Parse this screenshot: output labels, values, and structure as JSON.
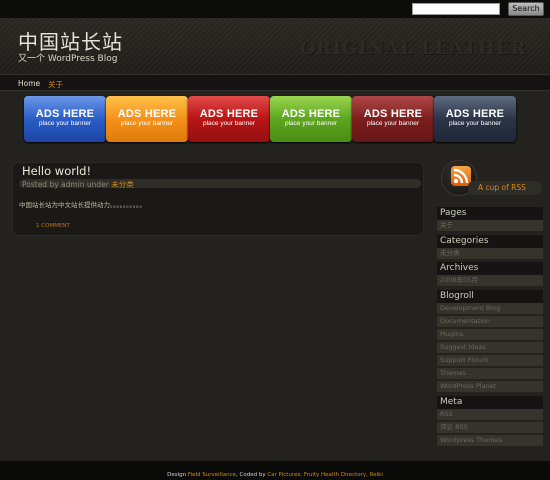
{
  "search": {
    "value": "",
    "button_label": "Search"
  },
  "header": {
    "title": "中国站长站",
    "tagline": "又一个 WordPress Blog",
    "watermark": "ORIGINAL LEATHER"
  },
  "nav": {
    "items": [
      {
        "label": "Home"
      },
      {
        "label": "关于"
      }
    ]
  },
  "ads": [
    {
      "title": "ADS HERE",
      "subtitle": "place your banner"
    },
    {
      "title": "ADS HERE",
      "subtitle": "place your banner"
    },
    {
      "title": "ADS HERE",
      "subtitle": "place your banner"
    },
    {
      "title": "ADS HERE",
      "subtitle": "place your banner"
    },
    {
      "title": "ADS HERE",
      "subtitle": "place your banner"
    },
    {
      "title": "ADS HERE",
      "subtitle": "place your banner"
    }
  ],
  "post": {
    "title": "Hello world!",
    "meta_prefix": "Posted by admin under",
    "category": "未分类",
    "body": "中国站长站为中文站长提供动力。。。。。。。。。。",
    "comments": "1 COMMENT"
  },
  "sidebar": {
    "rss_label": "A cup of RSS",
    "widgets": [
      {
        "title": "Pages",
        "items": [
          "关于"
        ]
      },
      {
        "title": "Categories",
        "items": [
          "未分类"
        ]
      },
      {
        "title": "Archives",
        "items": [
          "2008年05月"
        ]
      },
      {
        "title": "Blogroll",
        "items": [
          "Development Blog",
          "Documentation",
          "Plugins",
          "Suggest Ideas",
          "Support Forum",
          "Themes",
          "WordPress Planet"
        ]
      },
      {
        "title": "Meta",
        "items": [
          "RSS",
          "评论 RSS",
          "Wordpress Themes"
        ]
      }
    ]
  },
  "footer": {
    "design_label": "Design",
    "design_by": "Field Surveillance",
    "coded_label": ", Coded by",
    "links": "Car Pictures, Fruity Health Directory, Reiki"
  },
  "colors": {
    "accent": "#d48a1a",
    "background": "#23221e"
  }
}
